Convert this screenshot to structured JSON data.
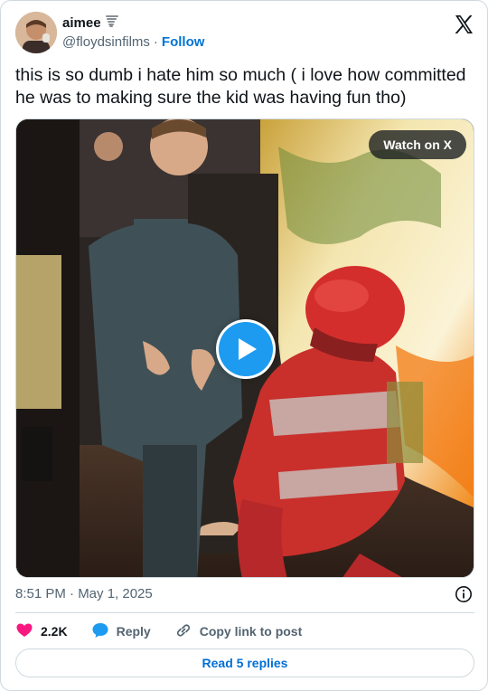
{
  "header": {
    "display_name": "aimee",
    "name_emoji": "tornado-icon",
    "handle": "@floydsinfilms",
    "separator": "·",
    "follow_label": "Follow"
  },
  "tweet": {
    "text": "this is so dumb i hate him so much ( i love how committed he was to making sure the kid was having fun tho)"
  },
  "media": {
    "watch_label": "Watch on X"
  },
  "meta": {
    "timestamp": "8:51 PM · May 1, 2025"
  },
  "actions": {
    "likes": "2.2K",
    "reply_label": "Reply",
    "copy_label": "Copy link to post"
  },
  "footer": {
    "read_replies": "Read 5 replies"
  },
  "colors": {
    "accent": "#1d9bf0",
    "like": "#f91880",
    "link": "#0074d4"
  }
}
